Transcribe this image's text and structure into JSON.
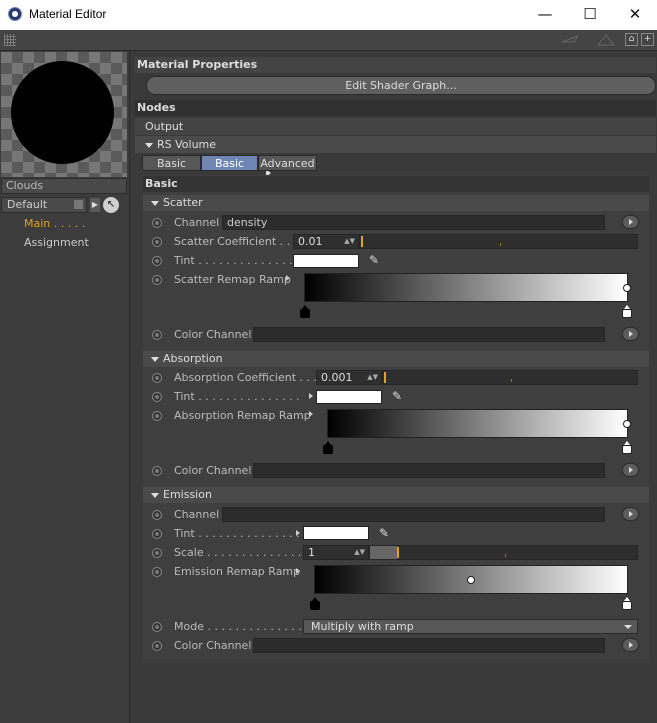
{
  "window": {
    "title": "Material Editor",
    "min": "—",
    "max": "☐",
    "close": "✕"
  },
  "left": {
    "material_name": "Clouds",
    "layout": "Default",
    "nav": [
      "Main . . . . .",
      "Assignment"
    ]
  },
  "header": {
    "material_properties": "Material Properties",
    "edit_shader_graph": "Edit Shader Graph...",
    "nodes": "Nodes",
    "output": "Output",
    "rs_volume": "RS Volume"
  },
  "tabs": [
    "Basic",
    "Basic",
    "Advanced"
  ],
  "basic_title": "Basic",
  "scatter": {
    "title": "Scatter",
    "channel_label": "Channel",
    "channel_value": "density",
    "coef_label": "Scatter Coefficient . . .",
    "coef_value": "0.01",
    "coef_fill": 0.0,
    "tint_label": "Tint . . . . . . . . . . . . . . .",
    "ramp_label": "Scatter Remap Ramp",
    "color_channel_label": "Color Channel"
  },
  "absorption": {
    "title": "Absorption",
    "coef_label": "Absorption Coefficient . . .",
    "coef_value": "0.001",
    "tint_label": "Tint . . . . . . . . . . . . . . .",
    "ramp_label": "Absorption Remap Ramp",
    "color_channel_label": "Color Channel"
  },
  "emission": {
    "title": "Emission",
    "channel_label": "Channel",
    "tint_label": "Tint . . . . . . . . . . . . . . .",
    "scale_label": "Scale . . . . . . . . . . . . . .",
    "scale_value": "1",
    "ramp_label": "Emission Remap Ramp",
    "mode_label": "Mode . . . . . . . . . . . . . . .",
    "mode_value": "Multiply with ramp",
    "color_channel_label": "Color Channel"
  },
  "colors": {
    "accent": "#e6a020",
    "tab_active": "#6f86b5",
    "tint": "#ffffff"
  }
}
